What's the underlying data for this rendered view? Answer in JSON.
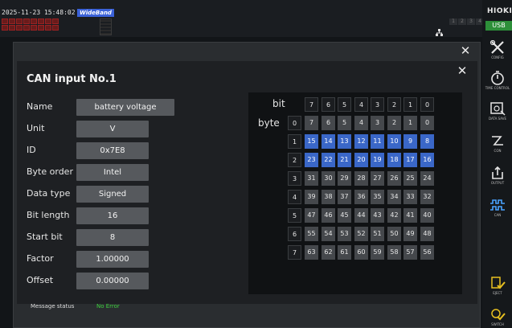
{
  "status": {
    "datetime": "2025-11-23 15:48:02",
    "mode_badge": "WideBand",
    "channel_numbers": [
      "1",
      "2",
      "3",
      "4"
    ]
  },
  "brand": {
    "name": "HIOKI",
    "usb_label": "USB",
    "usb_color": "#2d8f39"
  },
  "sidebar": {
    "items": [
      {
        "label": "CONFIG",
        "icon": "tools-icon"
      },
      {
        "label": "TIME CONTROL",
        "icon": "stopwatch-icon"
      },
      {
        "label": "DATA SAVE",
        "icon": "disk-icon"
      },
      {
        "label": "CON",
        "icon": "connection-icon"
      },
      {
        "label": "OUTPUT",
        "icon": "export-icon"
      },
      {
        "label": "CAN",
        "icon": "can-wave-icon"
      }
    ],
    "bottom_items": [
      {
        "label": "EJECT",
        "icon": "eject-check-icon"
      },
      {
        "label": "SWITCH",
        "icon": "switch-check-icon"
      }
    ]
  },
  "dialog": {
    "title": "CAN input No.1",
    "fields": [
      {
        "label": "Name",
        "value": "battery voltage"
      },
      {
        "label": "Unit",
        "value": "V"
      },
      {
        "label": "ID",
        "value": "0x7E8"
      },
      {
        "label": "Byte order",
        "value": "Intel"
      },
      {
        "label": "Data type",
        "value": "Signed"
      },
      {
        "label": "Bit length",
        "value": "16"
      },
      {
        "label": "Start bit",
        "value": "8"
      },
      {
        "label": "Factor",
        "value": "1.00000"
      },
      {
        "label": "Offset",
        "value": "0.00000"
      }
    ],
    "footer_fragment": "Message status",
    "footer_value": "No Error"
  },
  "bit_table": {
    "bit_label": "bit",
    "byte_label": "byte",
    "bit_headers": [
      "7",
      "6",
      "5",
      "4",
      "3",
      "2",
      "1",
      "0"
    ],
    "rows": [
      {
        "byte": "0",
        "bits": [
          "7",
          "6",
          "5",
          "4",
          "3",
          "2",
          "1",
          "0"
        ],
        "selected": [
          false,
          false,
          false,
          false,
          false,
          false,
          false,
          false
        ]
      },
      {
        "byte": "1",
        "bits": [
          "15",
          "14",
          "13",
          "12",
          "11",
          "10",
          "9",
          "8"
        ],
        "selected": [
          true,
          true,
          true,
          true,
          true,
          true,
          true,
          true
        ]
      },
      {
        "byte": "2",
        "bits": [
          "23",
          "22",
          "21",
          "20",
          "19",
          "18",
          "17",
          "16"
        ],
        "selected": [
          true,
          true,
          true,
          true,
          true,
          true,
          true,
          true
        ]
      },
      {
        "byte": "3",
        "bits": [
          "31",
          "30",
          "29",
          "28",
          "27",
          "26",
          "25",
          "24"
        ],
        "selected": [
          false,
          false,
          false,
          false,
          false,
          false,
          false,
          false
        ]
      },
      {
        "byte": "4",
        "bits": [
          "39",
          "38",
          "37",
          "36",
          "35",
          "34",
          "33",
          "32"
        ],
        "selected": [
          false,
          false,
          false,
          false,
          false,
          false,
          false,
          false
        ]
      },
      {
        "byte": "5",
        "bits": [
          "47",
          "46",
          "45",
          "44",
          "43",
          "42",
          "41",
          "40"
        ],
        "selected": [
          false,
          false,
          false,
          false,
          false,
          false,
          false,
          false
        ]
      },
      {
        "byte": "6",
        "bits": [
          "55",
          "54",
          "53",
          "52",
          "51",
          "50",
          "49",
          "48"
        ],
        "selected": [
          false,
          false,
          false,
          false,
          false,
          false,
          false,
          false
        ]
      },
      {
        "byte": "7",
        "bits": [
          "63",
          "62",
          "61",
          "60",
          "59",
          "58",
          "57",
          "56"
        ],
        "selected": [
          false,
          false,
          false,
          false,
          false,
          false,
          false,
          false
        ]
      }
    ],
    "selected_color": "#3a67c8",
    "cell_color": "#45484c"
  },
  "controls": {
    "close_glyph": "✕"
  }
}
